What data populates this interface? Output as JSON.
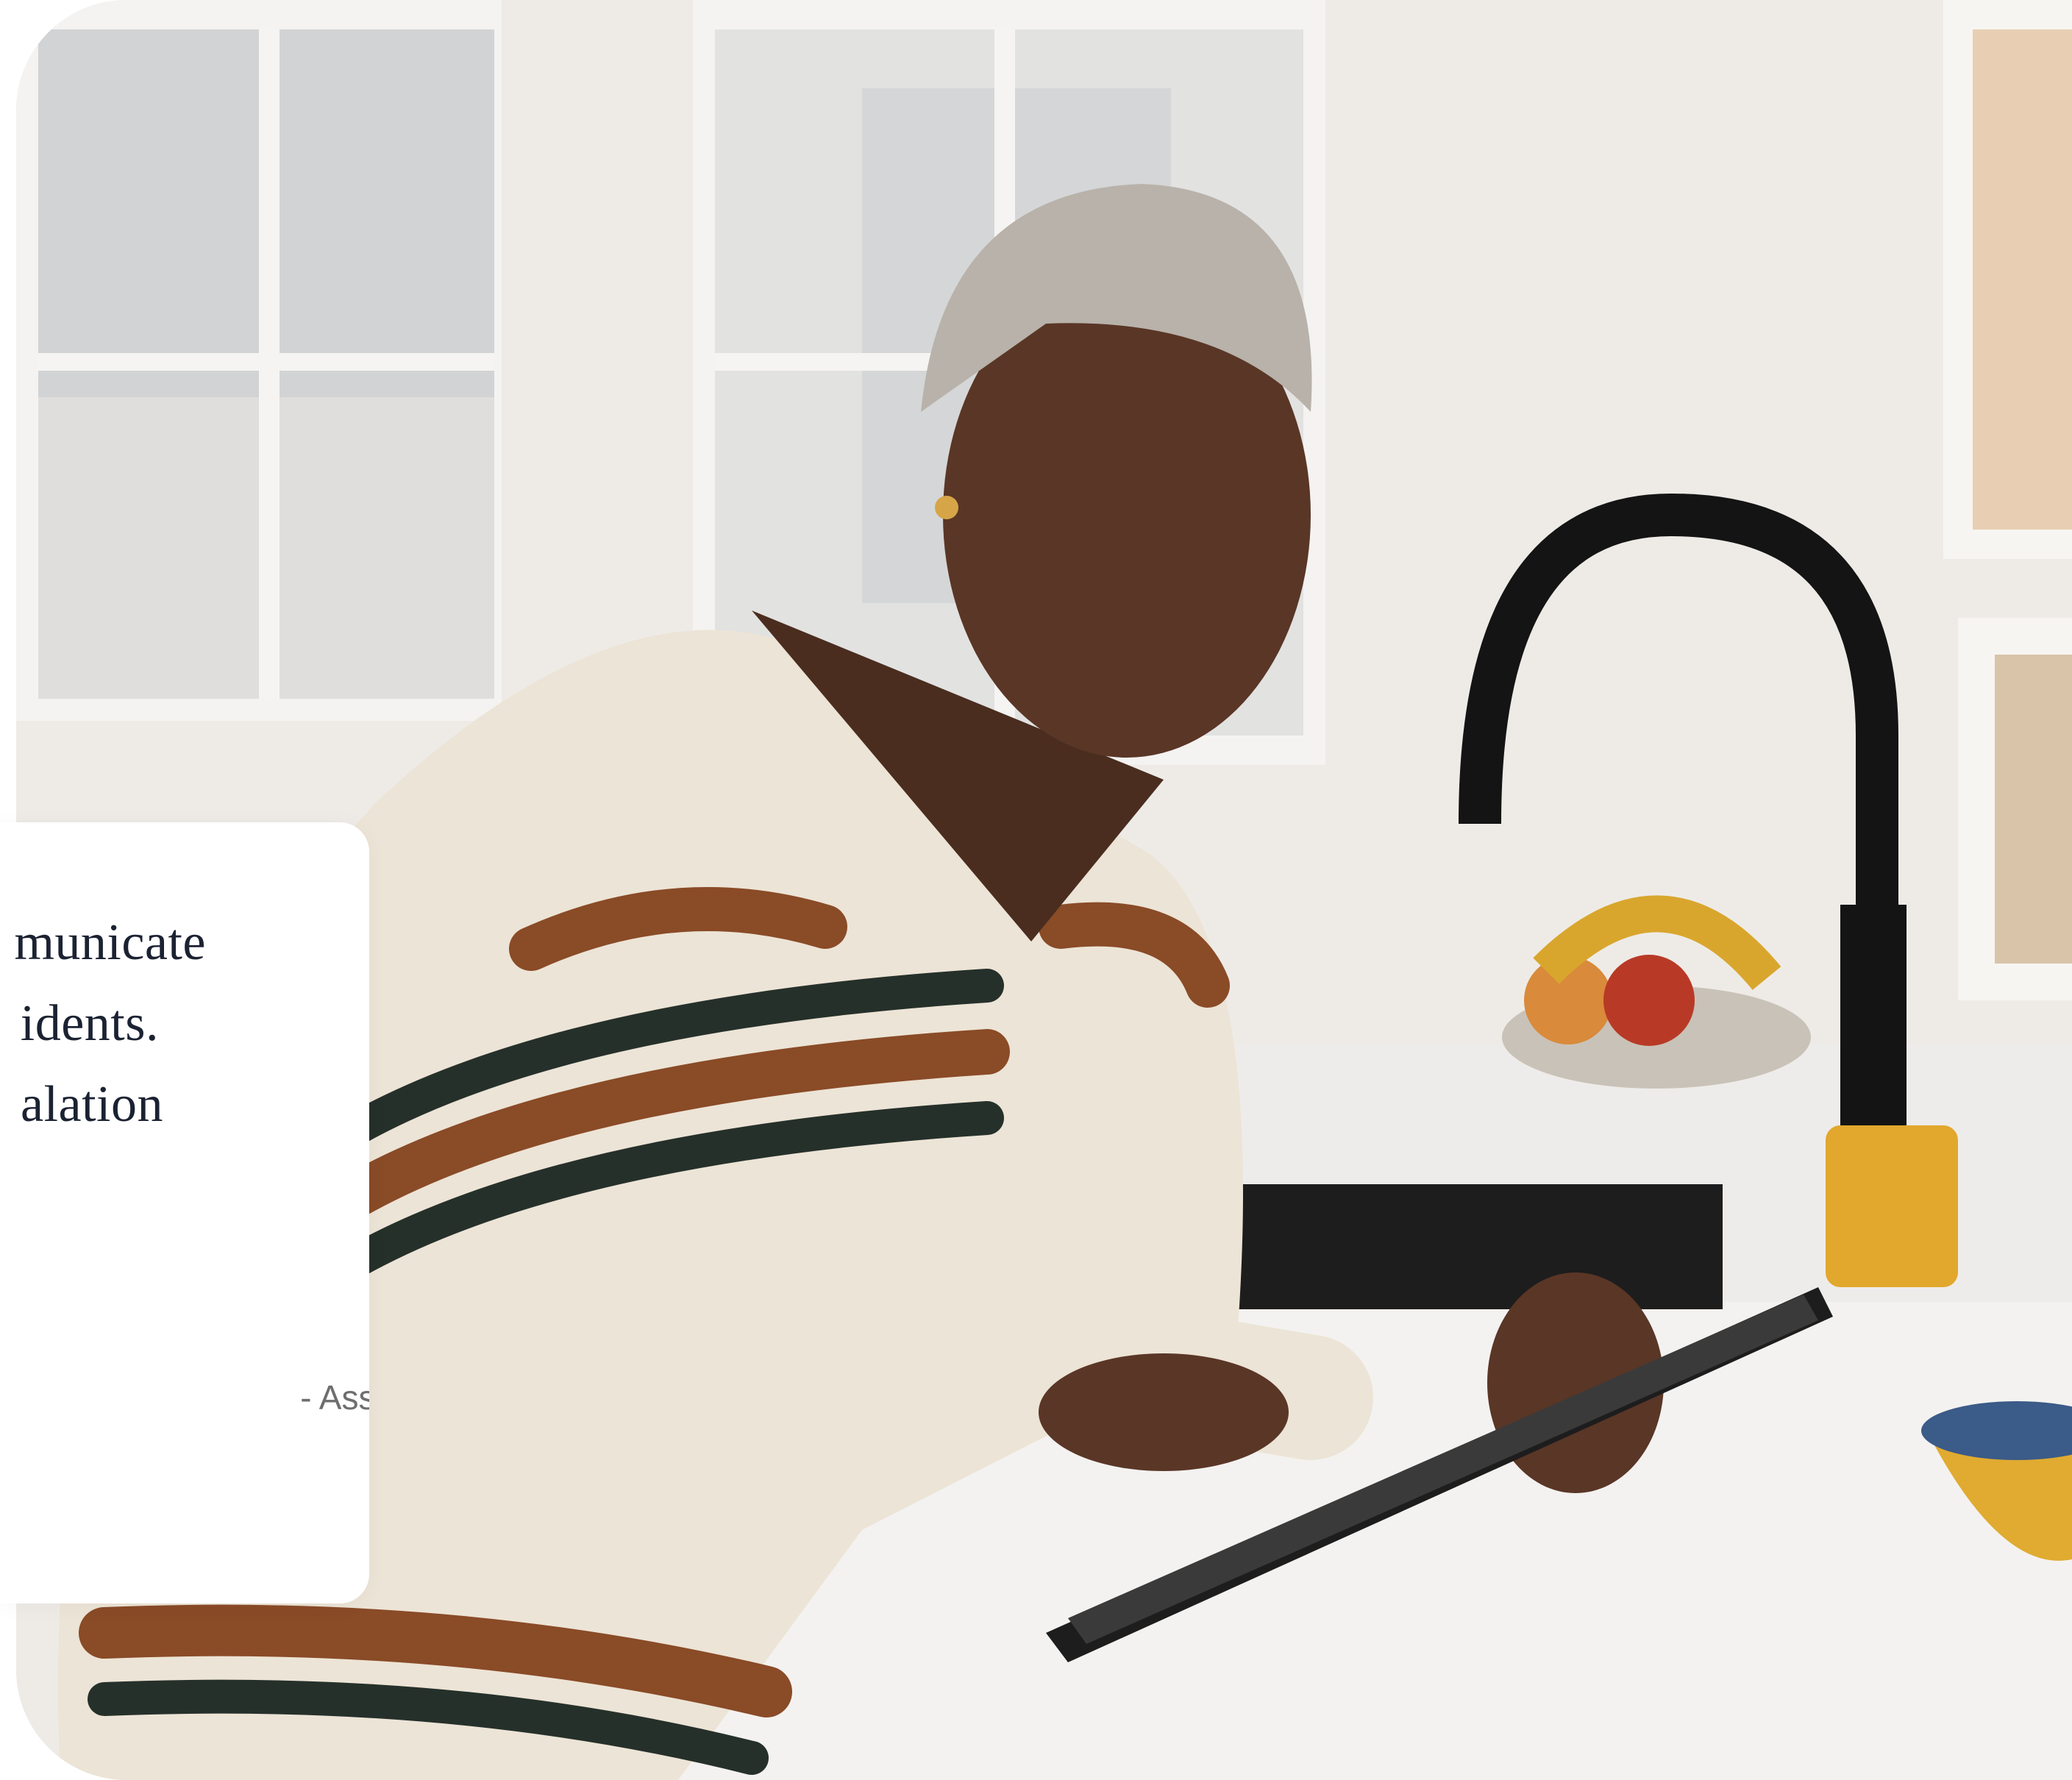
{
  "hero": {
    "image_name": "woman-using-tablet-in-kitchen"
  },
  "quote": {
    "lines": [
      "municate",
      "idents.",
      "alation"
    ],
    "attribution": "- Associations"
  },
  "colors": {
    "quote_text": "#1b2232",
    "attribution_text": "#6e6e6e",
    "card_background": "#ffffff"
  }
}
